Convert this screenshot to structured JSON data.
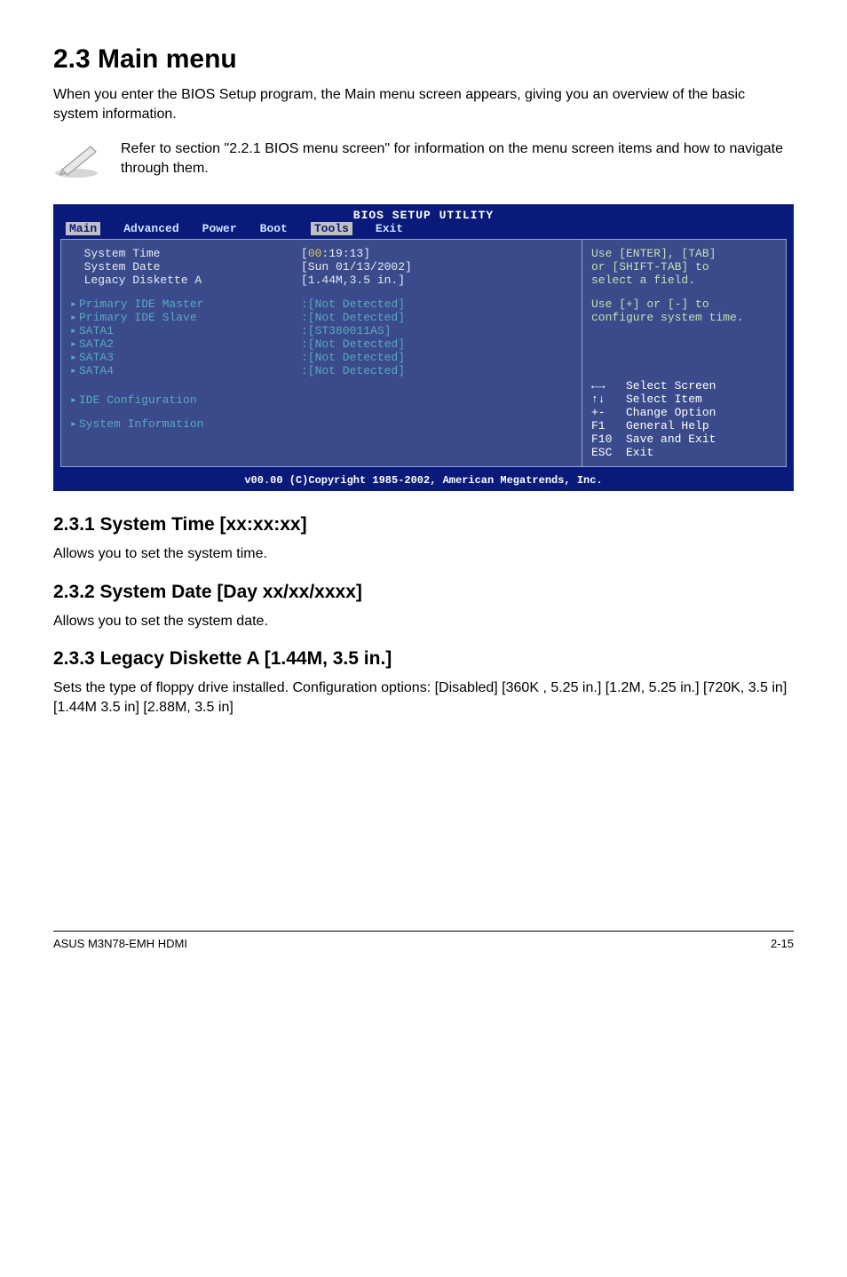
{
  "page": {
    "title": "2.3    Main menu",
    "intro": "When you enter the BIOS Setup program, the Main menu screen appears, giving you an overview of the basic system information.",
    "note": "Refer to section \"2.2.1 BIOS menu screen\" for information on the menu screen items and how to navigate through them."
  },
  "bios": {
    "title": "BIOS SETUP UTILITY",
    "tabs": [
      "Main",
      "Advanced",
      "Power",
      "Boot",
      "Tools",
      "Exit"
    ],
    "rows": {
      "system_time": {
        "label": "System Time",
        "value": "[00:19:13]",
        "hour": "00",
        "rest": ":19:13]"
      },
      "system_date": {
        "label": "System Date",
        "value": "[Sun 01/13/2002]"
      },
      "legacy_diskette": {
        "label": "Legacy Diskette A",
        "value": "[1.44M,3.5 in.]"
      },
      "pim": {
        "label": "Primary IDE Master",
        "value": ":[Not Detected]"
      },
      "pis": {
        "label": "Primary IDE Slave",
        "value": ":[Not Detected]"
      },
      "s1": {
        "label": "SATA1",
        "value": ":[ST380011AS]"
      },
      "s2": {
        "label": "SATA2",
        "value": ":[Not Detected]"
      },
      "s3": {
        "label": "SATA3",
        "value": ":[Not Detected]"
      },
      "s4": {
        "label": "SATA4",
        "value": ":[Not Detected]"
      },
      "idecfg": {
        "label": "IDE Configuration"
      },
      "sysinfo": {
        "label": "System Information"
      }
    },
    "help": {
      "l1": "Use [ENTER], [TAB]",
      "l2": "or [SHIFT-TAB] to",
      "l3": "select a field.",
      "l4": "Use [+] or [-] to",
      "l5": "configure system time.",
      "nav1": "←→   Select Screen",
      "nav2": "↑↓   Select Item",
      "nav3": "+-   Change Option",
      "nav4": "F1   General Help",
      "nav5": "F10  Save and Exit",
      "nav6": "ESC  Exit"
    },
    "footer": "v00.00 (C)Copyright 1985-2002, American Megatrends, Inc."
  },
  "subsections": {
    "s1": {
      "title": "2.3.1     System Time [xx:xx:xx]",
      "body": "Allows you to set the system time."
    },
    "s2": {
      "title": "2.3.2     System Date [Day xx/xx/xxxx]",
      "body": "Allows you to set the system date."
    },
    "s3": {
      "title": "2.3.3     Legacy Diskette A [1.44M, 3.5 in.]",
      "body": "Sets the type of floppy drive installed. Configuration options: [Disabled] [360K , 5.25 in.] [1.2M, 5.25 in.] [720K, 3.5 in] [1.44M 3.5 in] [2.88M, 3.5 in]"
    }
  },
  "footer": {
    "left": "ASUS M3N78-EMH HDMI",
    "right": "2-15"
  }
}
